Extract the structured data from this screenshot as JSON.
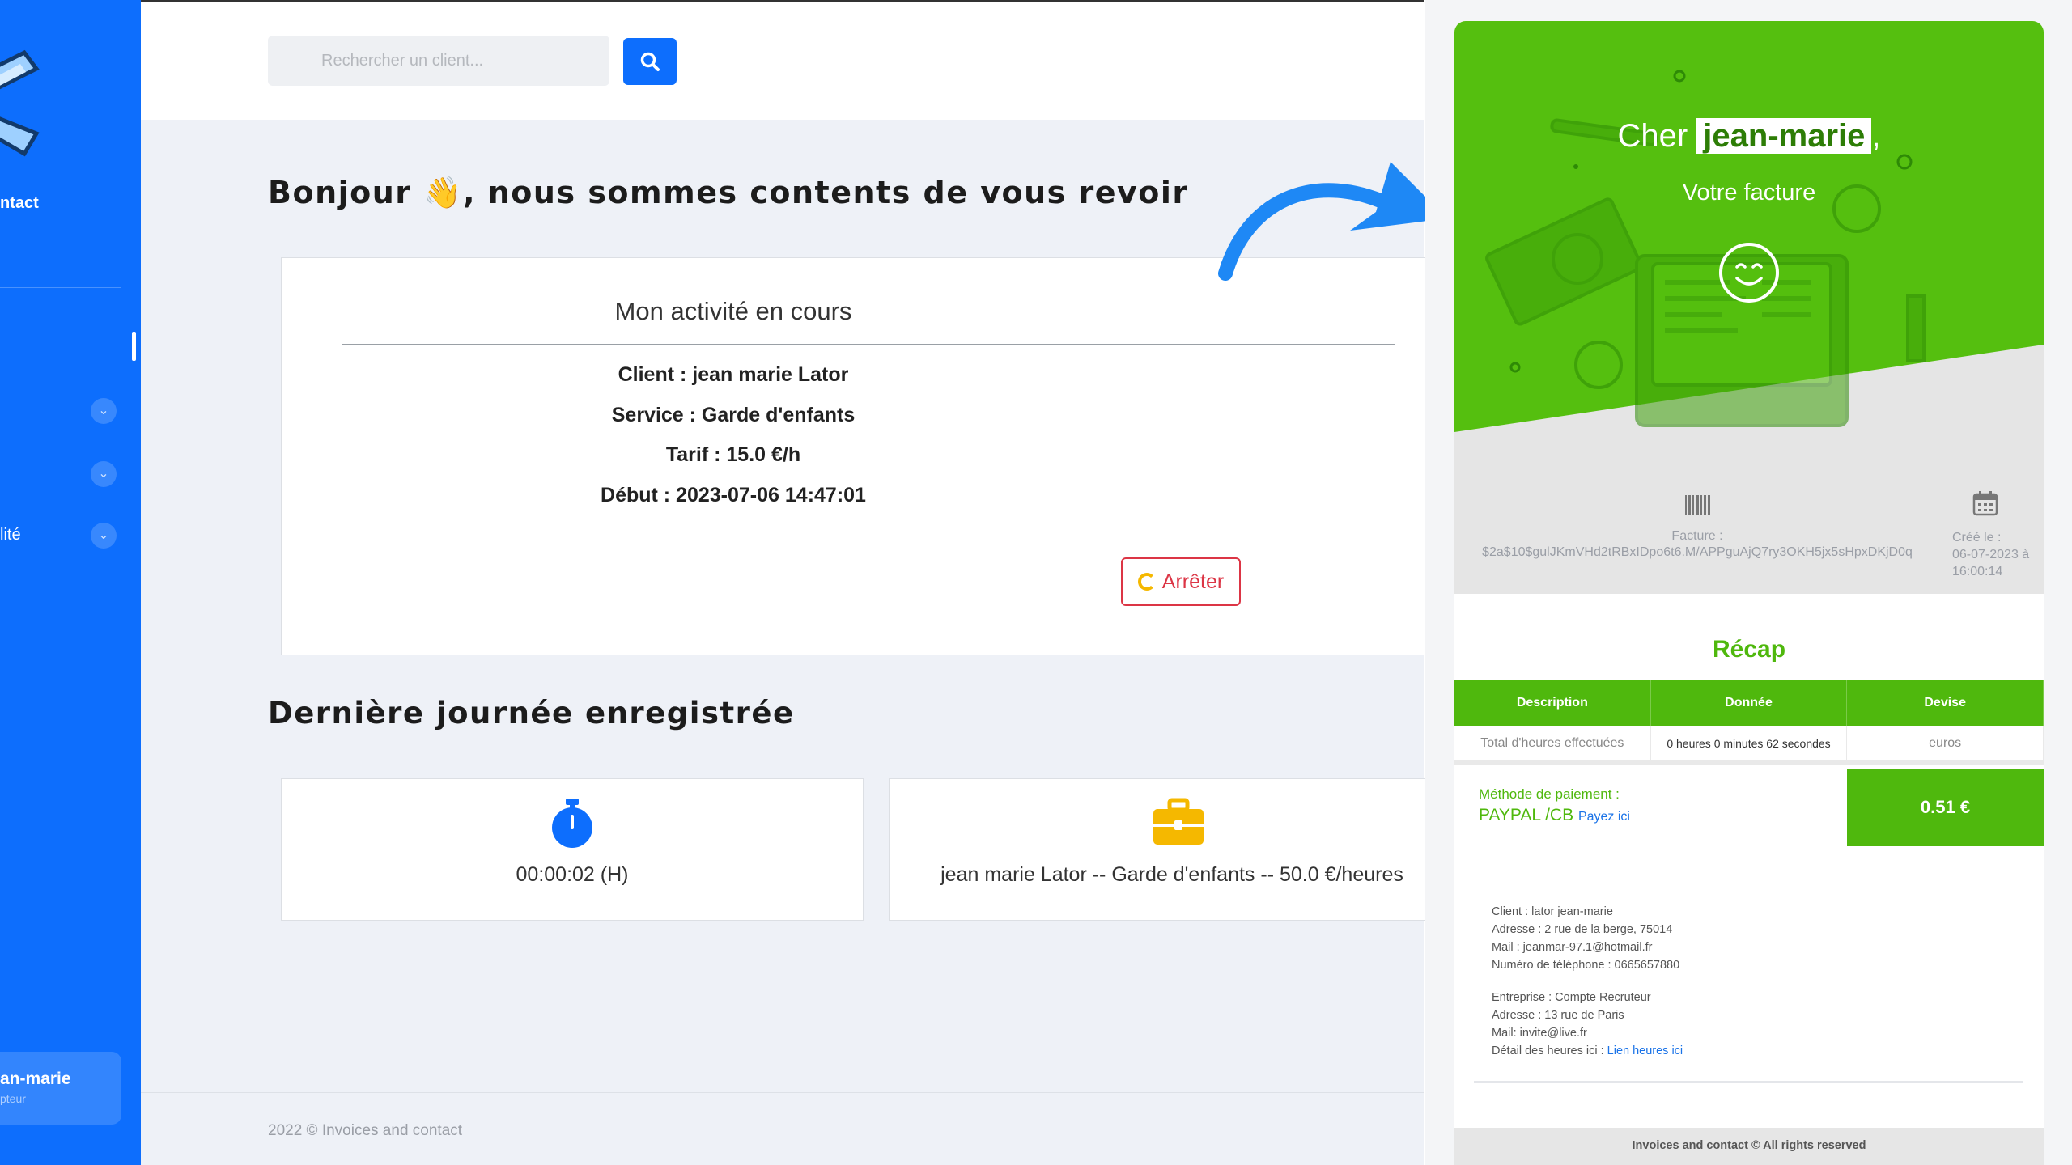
{
  "sidebar": {
    "contact_label": "ntact",
    "items": [
      {
        "label": ""
      },
      {
        "label": ""
      },
      {
        "label": "lité"
      }
    ],
    "user": {
      "name": "an-marie",
      "role": "pteur"
    }
  },
  "search": {
    "placeholder": "Rechercher un client..."
  },
  "greeting": {
    "text": "Bonjour 👋, nous sommes contents de vous revoir"
  },
  "activity": {
    "title": "Mon activité en cours",
    "client": "Client : jean marie Lator",
    "service": "Service : Garde d'enfants",
    "tarif": "Tarif : 15.0 €/h",
    "debut": "Début : 2023-07-06 14:47:01",
    "stop_label": "Arrêter"
  },
  "last_day": {
    "title": "Dernière journée enregistrée",
    "duration": "00:00:02 (H)",
    "summary": "jean marie Lator -- Garde d'enfants -- 50.0 €/heures"
  },
  "footer": {
    "text": "2022 © Invoices and contact"
  },
  "invoice": {
    "cher": "Cher",
    "name": "jean-marie",
    "comma": ",",
    "subtitle": "Votre facture",
    "facture_label": "Facture :",
    "facture_value": "$2a$10$gulJKmVHd2tRBxIDpo6t6.M/APPguAjQ7ry3OKH5jx5sHpxDKjD0q",
    "created_label": "Créé le :",
    "created_value": "06-07-2023 à 16:00:14",
    "recap": "Récap",
    "table": {
      "headers": [
        "Description",
        "Donnée",
        "Devise"
      ],
      "row": [
        "Total d'heures effectuées",
        "0 heures 0 minutes 62 secondes",
        "euros"
      ]
    },
    "payment": {
      "label": "Méthode de paiement :",
      "method": "PAYPAL /CB",
      "link": "Payez ici",
      "amount": "0.51 €"
    },
    "client_details": [
      "Client : lator jean-marie",
      "Adresse : 2 rue de la berge, 75014",
      "Mail : jeanmar-97.1@hotmail.fr",
      "Numéro de téléphone : 0665657880"
    ],
    "company_details": [
      "Entreprise : Compte Recruteur",
      "Adresse : 13 rue de Paris",
      "Mail: invite@live.fr"
    ],
    "hours_label": "Détail des heures ici :",
    "hours_link": "Lien heures ici",
    "footer": "Invoices and contact © All rights reserved"
  },
  "colors": {
    "primary": "#0d6efd",
    "green": "#4fb80d",
    "danger": "#dc3545",
    "warning": "#f5b800"
  }
}
